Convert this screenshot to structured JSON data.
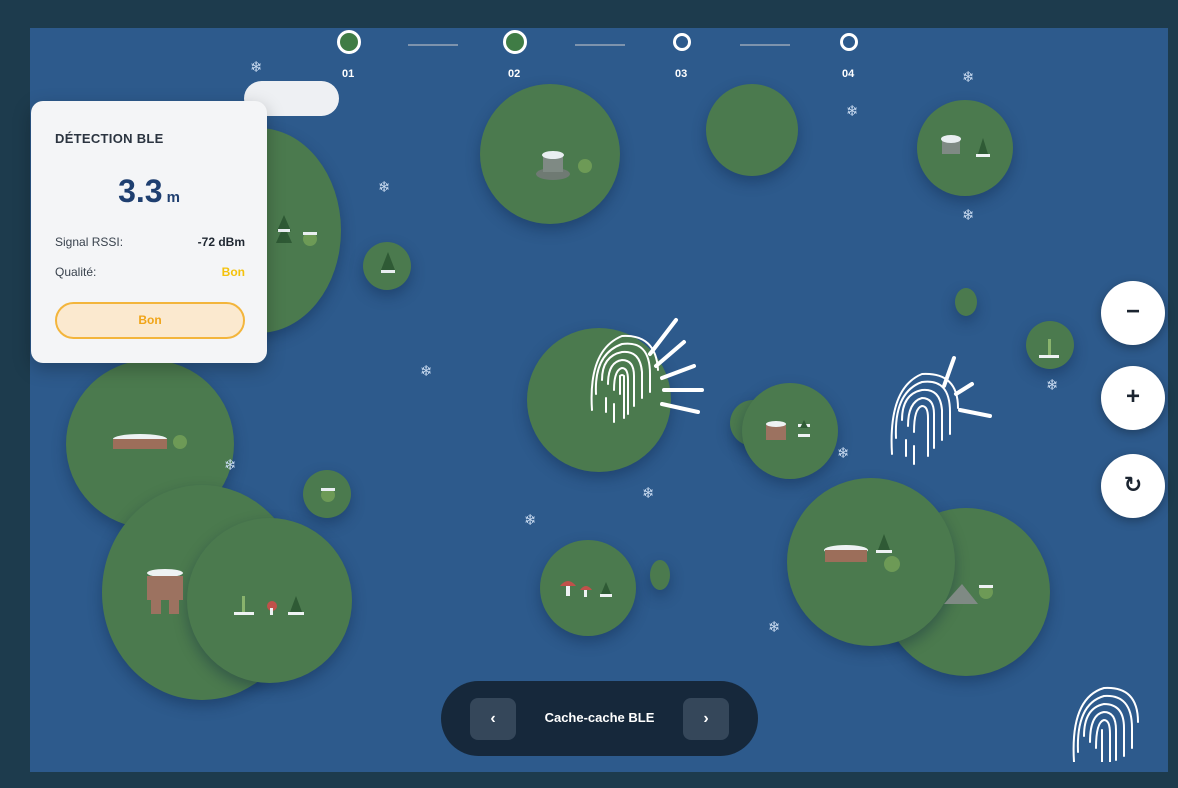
{
  "stepper": {
    "steps": [
      {
        "label": "01",
        "state": "done"
      },
      {
        "label": "02",
        "state": "done"
      },
      {
        "label": "03",
        "state": "pending"
      },
      {
        "label": "04",
        "state": "pending"
      }
    ]
  },
  "panel": {
    "title": "DÉTECTION BLE",
    "distance_value": "3.3",
    "distance_unit": "m",
    "rssi_label": "Signal RSSI:",
    "rssi_value": "-72 dBm",
    "quality_label": "Qualité:",
    "quality_value": "Bon",
    "quality_button": "Bon"
  },
  "controls": {
    "zoom_out": "−",
    "zoom_in": "+",
    "reset": "↻"
  },
  "nav": {
    "prev": "‹",
    "title": "Cache-cache BLE",
    "next": "›"
  },
  "colors": {
    "map_water": "#2d5a8c",
    "island_green": "#4b7a4e",
    "quality_accent": "#f3b53c",
    "distance_text": "#1f3f70"
  },
  "icons": {
    "snowflake": "❄",
    "fingerprint": "fingerprint-icon"
  }
}
